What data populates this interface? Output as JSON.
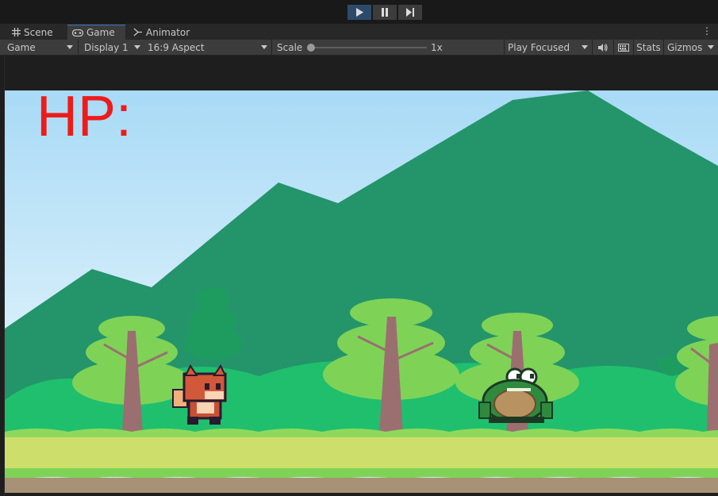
{
  "playbar": {
    "icons": [
      "play-icon",
      "pause-icon",
      "step-icon"
    ]
  },
  "tabs": [
    {
      "label": "Scene",
      "icon": "grid-icon"
    },
    {
      "label": "Game",
      "icon": "gamepad-icon"
    },
    {
      "label": "Animator",
      "icon": "animator-icon"
    }
  ],
  "toolbar": {
    "view_mode": "Game",
    "display": "Display 1",
    "aspect": "16:9 Aspect",
    "scale_label": "Scale",
    "scale_value": "1x",
    "play_mode": "Play Focused",
    "stats_label": "Stats",
    "gizmos_label": "Gizmos"
  },
  "game": {
    "hp_label": "HP:",
    "colors": {
      "sky_top": "#aedcf5",
      "sky_bottom": "#d2ecfa",
      "mountain": "#24946a",
      "grass": "#8ed95c",
      "path": "#cddf6a",
      "dirt": "#a89276",
      "hp_text": "#ee1b1b"
    }
  }
}
